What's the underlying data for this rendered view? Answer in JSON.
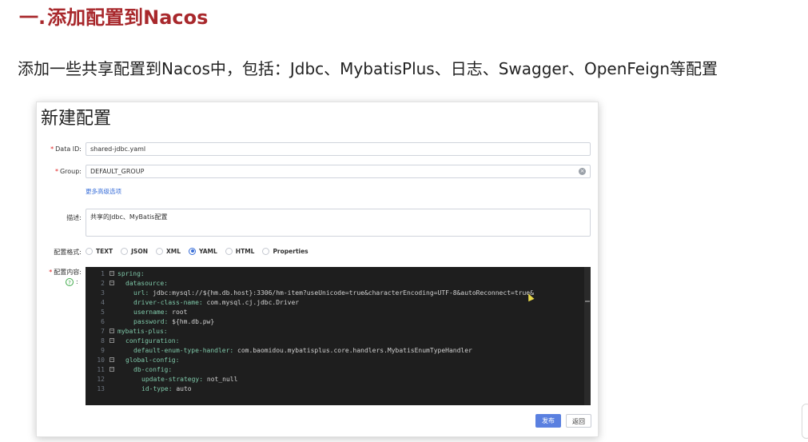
{
  "heading": {
    "number": "一.",
    "text": "添加配置到Nacos"
  },
  "intro": "添加一些共享配置到Nacos中，包括：Jdbc、MybatisPlus、日志、Swagger、OpenFeign等配置",
  "dialog": {
    "title": "新建配置",
    "data_id": {
      "label": "Data ID:",
      "value": "shared-jdbc.yaml"
    },
    "group": {
      "label": "Group:",
      "value": "DEFAULT_GROUP"
    },
    "advanced_link": "更多高级选项",
    "description": {
      "label": "描述:",
      "value": "共享的Jdbc、MyBatis配置"
    },
    "format": {
      "label": "配置格式:",
      "options": [
        "TEXT",
        "JSON",
        "XML",
        "YAML",
        "HTML",
        "Properties"
      ],
      "selected": "YAML"
    },
    "content_label": "配置内容:",
    "content_colon": ":",
    "code_lines": [
      {
        "n": "1",
        "fold": true,
        "indent": 0,
        "key": "spring:",
        "val": ""
      },
      {
        "n": "2",
        "fold": true,
        "indent": 1,
        "key": "datasource:",
        "val": ""
      },
      {
        "n": "3",
        "fold": false,
        "indent": 2,
        "key": "url:",
        "val": " jdbc:mysql://${hm.db.host}:3306/hm-item?useUnicode=true&characterEncoding=UTF-8&autoReconnect=true&"
      },
      {
        "n": "4",
        "fold": false,
        "indent": 2,
        "key": "driver-class-name:",
        "val": " com.mysql.cj.jdbc.Driver"
      },
      {
        "n": "5",
        "fold": false,
        "indent": 2,
        "key": "username:",
        "val": " root"
      },
      {
        "n": "6",
        "fold": false,
        "indent": 2,
        "key": "password:",
        "val": " ${hm.db.pw}"
      },
      {
        "n": "7",
        "fold": true,
        "indent": 0,
        "key": "mybatis-plus:",
        "val": ""
      },
      {
        "n": "8",
        "fold": true,
        "indent": 1,
        "key": "configuration:",
        "val": ""
      },
      {
        "n": "9",
        "fold": false,
        "indent": 2,
        "key": "default-enum-type-handler:",
        "val": " com.baomidou.mybatisplus.core.handlers.MybatisEnumTypeHandler"
      },
      {
        "n": "10",
        "fold": true,
        "indent": 1,
        "key": "global-config:",
        "val": ""
      },
      {
        "n": "11",
        "fold": true,
        "indent": 2,
        "key": "db-config:",
        "val": ""
      },
      {
        "n": "12",
        "fold": false,
        "indent": 3,
        "key": "update-strategy:",
        "val": " not_null"
      },
      {
        "n": "13",
        "fold": false,
        "indent": 3,
        "key": "id-type:",
        "val": " auto"
      }
    ],
    "buttons": {
      "publish": "发布",
      "back": "返回"
    }
  },
  "colors": {
    "heading": "#a8282c",
    "accent": "#3a6fd8",
    "editor_bg": "#1e1e1e",
    "yaml_key": "#7ec7a8"
  }
}
